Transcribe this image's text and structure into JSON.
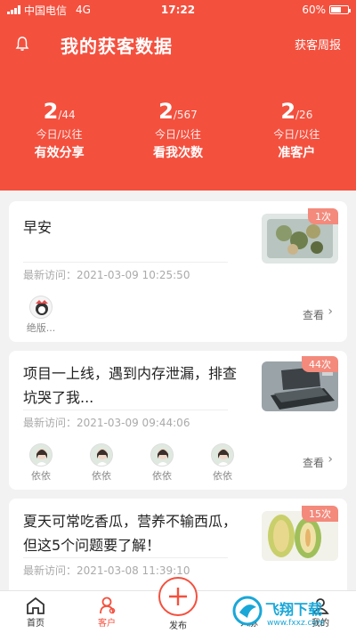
{
  "status": {
    "carrier": "中国电信",
    "network": "4G",
    "time": "17:22",
    "battery": "60%",
    "battery_level": 0.6
  },
  "header": {
    "title": "我的获客数据",
    "weekly_report": "获客周报"
  },
  "stats": [
    {
      "today": "2",
      "total": "/44",
      "sub": "今日/以往",
      "label": "有效分享"
    },
    {
      "today": "2",
      "total": "/567",
      "sub": "今日/以往",
      "label": "看我次数"
    },
    {
      "today": "2",
      "total": "/26",
      "sub": "今日/以往",
      "label": "准客户"
    }
  ],
  "cards": [
    {
      "title": "早安",
      "visit": "最新访问：2021-03-09 10:25:50",
      "count": "1次",
      "view_more": "查看",
      "visitors": [
        "绝版..."
      ]
    },
    {
      "title": "项目一上线，遇到内存泄漏，排查坑哭了我...",
      "visit": "最新访问：2021-03-09 09:44:06",
      "count": "44次",
      "view_more": "查看",
      "visitors": [
        "依依",
        "依依",
        "依依",
        "依依"
      ]
    },
    {
      "title": "夏天可常吃香瓜，营养不输西瓜，但这5个问题要了解！",
      "visit": "最新访问：2021-03-08 11:39:10",
      "count": "15次"
    }
  ],
  "tabbar": {
    "home": "首页",
    "customers": "客户",
    "publish": "发布",
    "fourth": "人脉",
    "fifth": "我的"
  },
  "watermark": {
    "brand": "飞翔下载",
    "url": "www.fxxz.com"
  },
  "colors": {
    "accent": "#f4503e",
    "badge": "#f38a7c"
  }
}
